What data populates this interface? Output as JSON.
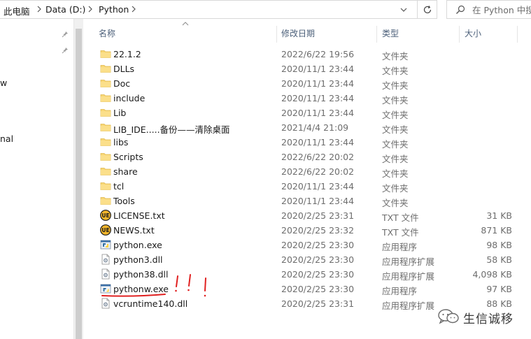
{
  "address_bar": {
    "breadcrumbs": [
      "此电脑",
      "Data (D:)",
      "Python"
    ]
  },
  "search": {
    "placeholder": "在 Python 中搜索"
  },
  "nav_pane": {
    "fragments": [
      "w",
      "nal"
    ]
  },
  "columns": {
    "name": "名称",
    "date": "修改日期",
    "type": "类型",
    "size": "大小"
  },
  "files": [
    {
      "name": "22.1.2",
      "date": "2022/6/22 19:56",
      "type": "文件夹",
      "size": "",
      "icon": "folder-icon"
    },
    {
      "name": "DLLs",
      "date": "2020/11/1 23:44",
      "type": "文件夹",
      "size": "",
      "icon": "folder-icon"
    },
    {
      "name": "Doc",
      "date": "2020/11/1 23:44",
      "type": "文件夹",
      "size": "",
      "icon": "folder-icon"
    },
    {
      "name": "include",
      "date": "2020/11/1 23:44",
      "type": "文件夹",
      "size": "",
      "icon": "folder-icon"
    },
    {
      "name": "Lib",
      "date": "2020/11/1 23:44",
      "type": "文件夹",
      "size": "",
      "icon": "folder-icon"
    },
    {
      "name": "LIB_IDE.....备份——清除桌面",
      "date": "2021/4/4 21:09",
      "type": "文件夹",
      "size": "",
      "icon": "folder-icon"
    },
    {
      "name": "libs",
      "date": "2020/11/1 23:44",
      "type": "文件夹",
      "size": "",
      "icon": "folder-icon"
    },
    {
      "name": "Scripts",
      "date": "2022/6/22 20:02",
      "type": "文件夹",
      "size": "",
      "icon": "folder-icon"
    },
    {
      "name": "share",
      "date": "2022/6/22 20:02",
      "type": "文件夹",
      "size": "",
      "icon": "folder-icon"
    },
    {
      "name": "tcl",
      "date": "2020/11/1 23:44",
      "type": "文件夹",
      "size": "",
      "icon": "folder-icon"
    },
    {
      "name": "Tools",
      "date": "2020/11/1 23:44",
      "type": "文件夹",
      "size": "",
      "icon": "folder-icon"
    },
    {
      "name": "LICENSE.txt",
      "date": "2020/2/25 23:31",
      "type": "TXT 文件",
      "size": "31 KB",
      "icon": "ultraedit-icon"
    },
    {
      "name": "NEWS.txt",
      "date": "2020/2/25 23:32",
      "type": "TXT 文件",
      "size": "871 KB",
      "icon": "ultraedit-icon"
    },
    {
      "name": "python.exe",
      "date": "2020/2/25 23:30",
      "type": "应用程序",
      "size": "98 KB",
      "icon": "python-exe-icon"
    },
    {
      "name": "python3.dll",
      "date": "2020/2/25 23:30",
      "type": "应用程序扩展",
      "size": "58 KB",
      "icon": "dll-icon"
    },
    {
      "name": "python38.dll",
      "date": "2020/2/25 23:30",
      "type": "应用程序扩展",
      "size": "4,098 KB",
      "icon": "dll-icon"
    },
    {
      "name": "pythonw.exe",
      "date": "2020/2/25 23:30",
      "type": "应用程序",
      "size": "97 KB",
      "icon": "pythonw-exe-icon"
    },
    {
      "name": "vcruntime140.dll",
      "date": "2020/2/25 23:31",
      "type": "应用程序扩展",
      "size": "88 KB",
      "icon": "dll-icon"
    }
  ],
  "watermark": {
    "text": "生信诚移"
  },
  "colors": {
    "folder": "#f8d775",
    "header_text": "#4c607a",
    "annotation": "#e02020",
    "secondary_text": "#6d6d6d"
  }
}
